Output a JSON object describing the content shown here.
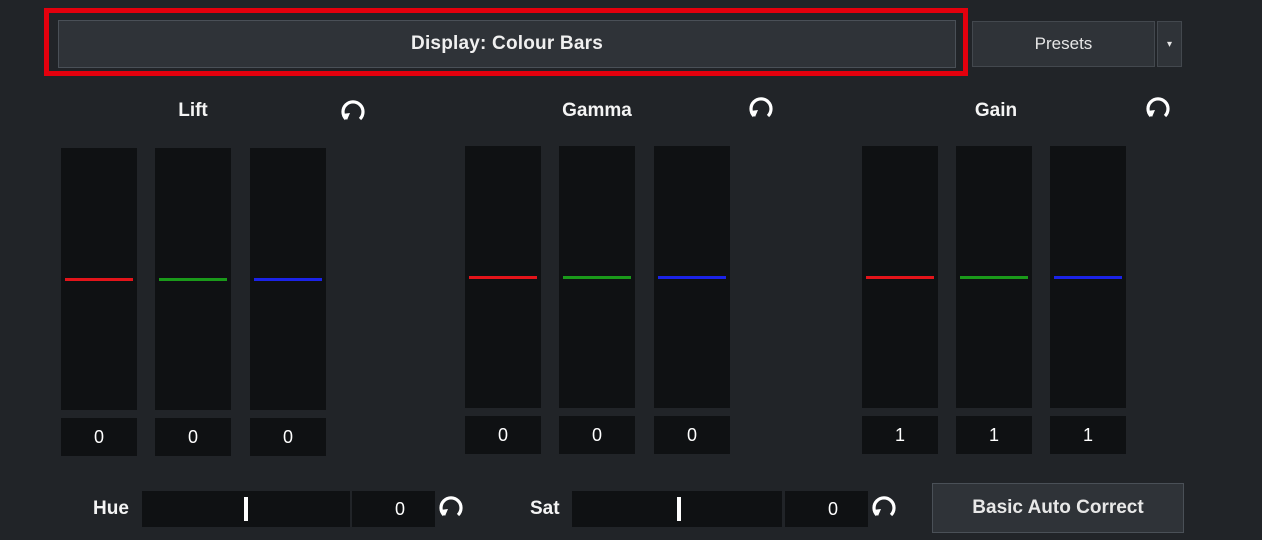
{
  "display_button": {
    "label": "Display: Colour Bars"
  },
  "presets": {
    "label": "Presets",
    "arrow": "▾"
  },
  "groups": {
    "lift": {
      "title": "Lift",
      "values": [
        "0",
        "0",
        "0"
      ]
    },
    "gamma": {
      "title": "Gamma",
      "values": [
        "0",
        "0",
        "0"
      ]
    },
    "gain": {
      "title": "Gain",
      "values": [
        "1",
        "1",
        "1"
      ]
    }
  },
  "channel_colors": {
    "red": "#e3141a",
    "green": "#1a9a1a",
    "blue": "#1b23e8"
  },
  "highlight_color": "#e4000d",
  "hue": {
    "label": "Hue",
    "value": "0"
  },
  "sat": {
    "label": "Sat",
    "value": "0"
  },
  "auto_correct": {
    "label": "Basic Auto Correct"
  },
  "icons": {
    "reset": "reset-icon",
    "dropdown": "chevron-down-icon"
  }
}
